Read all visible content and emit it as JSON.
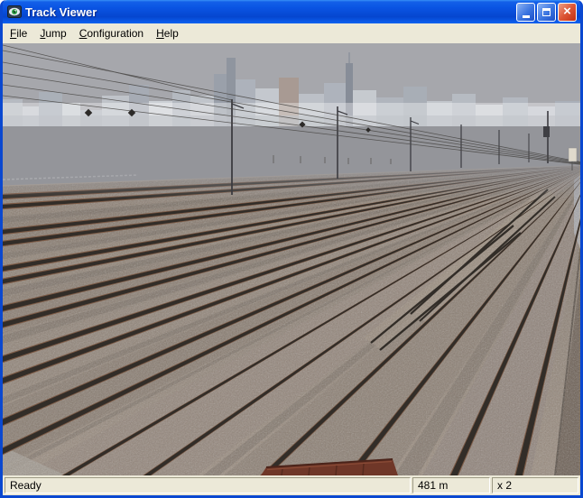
{
  "window": {
    "title": "Track Viewer"
  },
  "titlebar": {
    "close_glyph": "×",
    "icons": [
      "app-icon",
      "minimize-icon",
      "maximize-icon",
      "close-icon"
    ]
  },
  "menu": {
    "items": [
      {
        "label": "File",
        "accel": "F",
        "rest": "ile"
      },
      {
        "label": "Jump",
        "accel": "J",
        "rest": "ump"
      },
      {
        "label": "Configuration",
        "accel": "C",
        "rest": "onfiguration"
      },
      {
        "label": "Help",
        "accel": "H",
        "rest": "elp"
      }
    ]
  },
  "statusbar": {
    "status": "Ready",
    "distance": "481 m",
    "zoom": "x 2"
  },
  "colors": {
    "titlebar_gradient_top": "#3890f8",
    "titlebar_gradient_bottom": "#0546cf",
    "close_button": "#dd5636",
    "chrome": "#ece9d8",
    "frame": "#0a48d0",
    "sky": "#a6a7ac",
    "ground": "#94959a",
    "ballast": "#8b7d70",
    "rail": "#322d28",
    "rail_rust": "#7a5640"
  }
}
